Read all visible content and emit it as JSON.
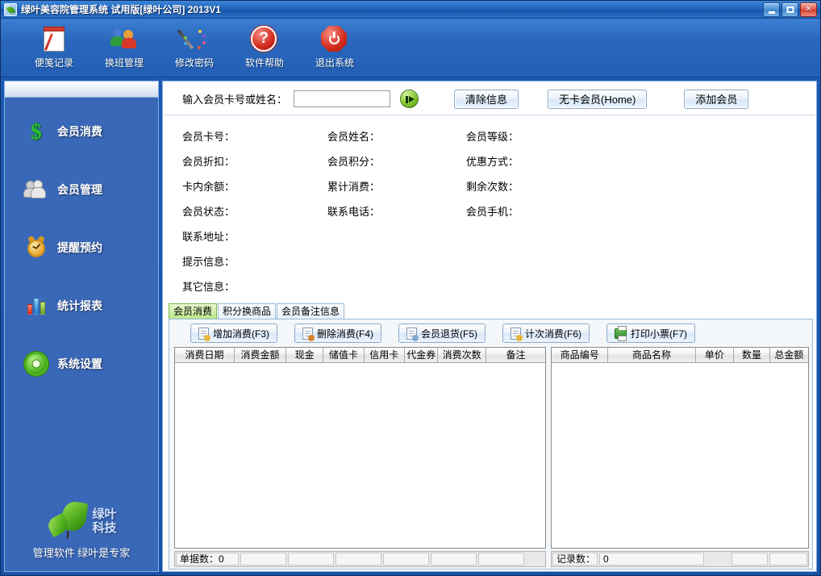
{
  "window": {
    "title": "绿叶美容院管理系统 试用版[绿叶公司] 2013V1",
    "app_icon": "leaf-app-icon",
    "minimize_label": "",
    "maximize_label": "",
    "close_label": "✕"
  },
  "toolbar": {
    "buttons": [
      {
        "label": "便笺记录",
        "icon": "notepad-pen-icon"
      },
      {
        "label": "换班管理",
        "icon": "two-people-icon"
      },
      {
        "label": "修改密码",
        "icon": "pencil-dots-icon"
      },
      {
        "label": "软件帮助",
        "icon": "question-mark-icon"
      },
      {
        "label": "退出系统",
        "icon": "power-off-icon"
      }
    ]
  },
  "sidebar": {
    "items": [
      {
        "label": "会员消费",
        "icon": "dollar-sign-icon"
      },
      {
        "label": "会员管理",
        "icon": "people-icon"
      },
      {
        "label": "提醒预约",
        "icon": "alarm-clock-icon"
      },
      {
        "label": "统计报表",
        "icon": "bar-chart-icon"
      },
      {
        "label": "系统设置",
        "icon": "gear-icon"
      }
    ],
    "logo": {
      "icon": "green-leaf-icon",
      "name_line1": "绿叶",
      "name_line2": "科技",
      "tagline": "管理软件 绿叶是专家"
    }
  },
  "search": {
    "label": "输入会员卡号或姓名：",
    "value": "",
    "placeholder": "",
    "go_icon": "play-forward-icon",
    "buttons": [
      {
        "label": "清除信息"
      },
      {
        "label": "无卡会员(Home)"
      },
      {
        "label": "添加会员"
      }
    ]
  },
  "member_info": {
    "rows": [
      [
        {
          "label": "会员卡号：",
          "value": ""
        },
        {
          "label": "会员姓名：",
          "value": ""
        },
        {
          "label": "会员等级：",
          "value": ""
        }
      ],
      [
        {
          "label": "会员折扣：",
          "value": ""
        },
        {
          "label": "会员积分：",
          "value": ""
        },
        {
          "label": "优惠方式：",
          "value": ""
        }
      ],
      [
        {
          "label": "卡内余额：",
          "value": ""
        },
        {
          "label": "累计消费：",
          "value": ""
        },
        {
          "label": "剩余次数：",
          "value": ""
        }
      ],
      [
        {
          "label": "会员状态：",
          "value": ""
        },
        {
          "label": "联系电话：",
          "value": ""
        },
        {
          "label": "会员手机：",
          "value": ""
        }
      ],
      [
        {
          "label": "联系地址：",
          "value": ""
        },
        {
          "label": "",
          "value": ""
        },
        {
          "label": "",
          "value": ""
        }
      ],
      [
        {
          "label": "提示信息：",
          "value": ""
        },
        {
          "label": "",
          "value": ""
        },
        {
          "label": "",
          "value": ""
        }
      ],
      [
        {
          "label": "其它信息：",
          "value": ""
        },
        {
          "label": "",
          "value": ""
        },
        {
          "label": "",
          "value": ""
        }
      ]
    ]
  },
  "tabs": [
    {
      "label": "会员消费",
      "active": true
    },
    {
      "label": "积分换商品",
      "active": false
    },
    {
      "label": "会员备注信息",
      "active": false
    }
  ],
  "actions": [
    {
      "label": "增加消费(F3)",
      "icon": "document-add-icon"
    },
    {
      "label": "删除消费(F4)",
      "icon": "document-delete-icon"
    },
    {
      "label": "会员退货(F5)",
      "icon": "document-return-icon"
    },
    {
      "label": "计次消费(F6)",
      "icon": "document-count-icon"
    },
    {
      "label": "打印小票(F7)",
      "icon": "printer-icon"
    }
  ],
  "consumption_grid": {
    "columns": [
      "消费日期",
      "消费金额",
      "现金",
      "储值卡",
      "信用卡",
      "代金券",
      "消费次数",
      "备注"
    ],
    "rows": []
  },
  "product_grid": {
    "columns": [
      "商品编号",
      "商品名称",
      "单价",
      "数量",
      "总金额"
    ],
    "rows": []
  },
  "status_left": {
    "cells": [
      "单据数：0",
      "",
      "",
      "",
      "",
      "",
      ""
    ]
  },
  "status_right": {
    "label": "记录数：",
    "value": "0",
    "extra_cells": [
      "",
      ""
    ]
  },
  "colors": {
    "titlebar_blue": "#2467bd",
    "window_blue": "#1e5bb5",
    "sidebar_blue": "#3a68b8",
    "active_tab_green": "#b9e88a",
    "accent_green": "#4fb51e",
    "close_red": "#d13b2d"
  }
}
